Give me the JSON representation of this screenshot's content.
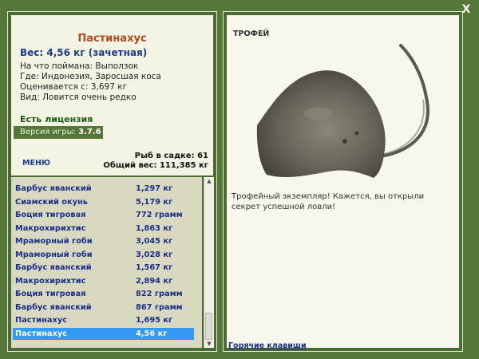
{
  "window": {
    "close_label": "X"
  },
  "fish": {
    "name": "Пастинахус",
    "weight": "Вес: 4,56 кг (зачетная)",
    "bait": "На что поймана: Выползок",
    "location": "Где: Индонезия, Заросшая коса",
    "valued_from": "Оценивается с: 3,697 кг",
    "rarity": "Вид: Ловится очень редко"
  },
  "license": "Есть лицензия",
  "version": {
    "label": "Версия игры: ",
    "number": "3.7.6"
  },
  "menu_label": "МЕНЮ",
  "stats": {
    "fish_in_net": "Рыб в садке: 61",
    "total_weight": "Общий вес: 111,385 кг"
  },
  "catch_list": [
    {
      "name": "Барбус яванский",
      "weight": "1,297 кг"
    },
    {
      "name": "Сиамский окунь",
      "weight": "5,179 кг"
    },
    {
      "name": "Боция тигровая",
      "weight": "772 грамм"
    },
    {
      "name": "Макрохирихтис",
      "weight": "1,863 кг"
    },
    {
      "name": "Мраморный гоби",
      "weight": "3,045 кг"
    },
    {
      "name": "Мраморный гоби",
      "weight": "3,028 кг"
    },
    {
      "name": "Барбус яванский",
      "weight": "1,567 кг"
    },
    {
      "name": "Макрохирихтис",
      "weight": "2,894 кг"
    },
    {
      "name": "Боция тигровая",
      "weight": "822 грамм"
    },
    {
      "name": "Барбус яванский",
      "weight": "867 грамм"
    },
    {
      "name": "Пастинахус",
      "weight": "1,695 кг"
    },
    {
      "name": "Пастинахус",
      "weight": "4,56 кг"
    }
  ],
  "selected_index": 11,
  "trophy": {
    "label": "ТРОФЕЙ",
    "text": "Трофейный экземпляр! Кажется, вы открыли секрет успешной ловли!"
  },
  "hotkeys_label": "Горячие клавиши",
  "colors": {
    "accent_title": "#b5481c",
    "list_text": "#1c2f86",
    "selection": "#3399f3",
    "frame": "#55773a"
  }
}
